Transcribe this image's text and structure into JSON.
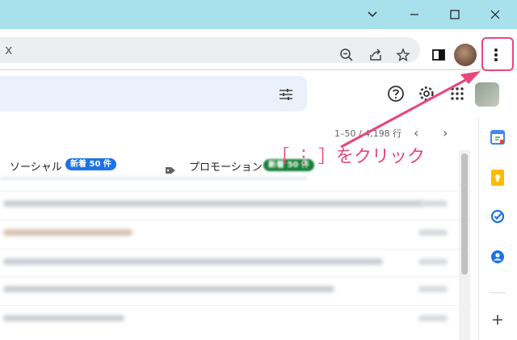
{
  "browser": {
    "omnibox_text": "x"
  },
  "gmail": {
    "pagination": "1–50 / 4,198 行",
    "tabs": [
      {
        "label": "ソーシャル",
        "badge": "新着 50 件",
        "badge_color": "#1a73e8"
      },
      {
        "label": "プロモーション",
        "badge": "新着 50 件",
        "badge_color": "#188038"
      }
    ]
  },
  "annotation": {
    "text": "［ ⋮ ］をクリック",
    "color": "#e8467c"
  },
  "colors": {
    "titlebar": "#a8e0eb",
    "search_bg": "#eaf1fb"
  }
}
